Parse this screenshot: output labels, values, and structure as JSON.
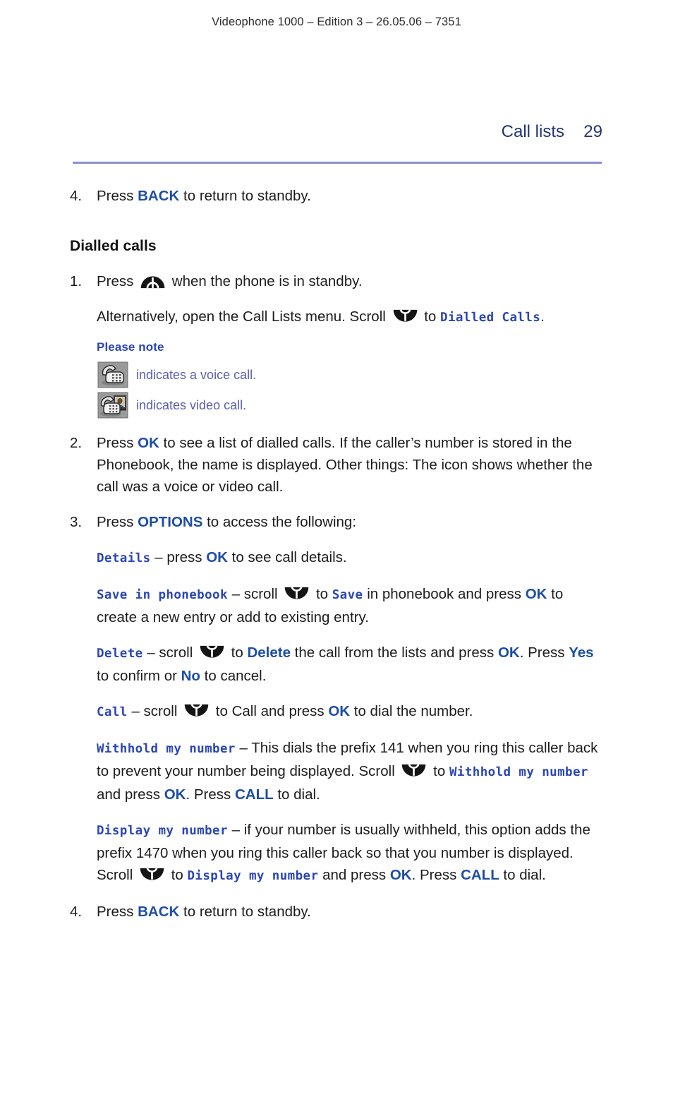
{
  "running_header": "Videophone 1000 – Edition 3 – 26.05.06 – 7351",
  "chapter": {
    "title": "Call lists",
    "page_number": "29"
  },
  "colors": {
    "rule": "#8b90ce",
    "chapter_heading": "#22356e",
    "key_blue": "#1d4ea4",
    "lcd_menu_blue": "#2a45b5",
    "note_text": "#5a5fae",
    "body_text": "#1c1c1c"
  },
  "steps": {
    "step4a": {
      "number": "4.",
      "text_1": "Press ",
      "key": "BACK",
      "text_2": " to return to standby."
    },
    "subheading": "Dialled calls",
    "step1": {
      "number": "1.",
      "line1_a": "Press ",
      "line1_b": " when the phone is in standby.",
      "line2_a": "Alternatively, open the Call Lists menu. Scroll ",
      "line2_b": " to ",
      "line2_menu": "Dialled Calls",
      "line2_c": "."
    },
    "please_note": {
      "title": "Please note",
      "voice": {
        "icon": "voice-call-icon",
        "text": "indicates a voice call."
      },
      "video": {
        "icon": "video-call-icon",
        "text": "indicates video call."
      }
    },
    "step2": {
      "number": "2.",
      "text_1": "Press ",
      "key": "OK",
      "text_2": " to see a list of dialled calls. If the caller’s number is stored in the Phonebook, the name is displayed. Other things: The icon shows whether the call was a voice or video call."
    },
    "step3": {
      "number": "3.",
      "text_1": "Press ",
      "key": "OPTIONS",
      "text_2": " to access the following:",
      "options": {
        "details": {
          "menu": "Details",
          "t1": " – press ",
          "key1": "OK",
          "t2": " to see call details."
        },
        "save_in_phonebook": {
          "menu": "Save in phonebook",
          "t1": " – scroll ",
          "t2": " to ",
          "menu2": "Save",
          "t3": " in phonebook and press ",
          "key1": "OK",
          "t4": " to create a new entry or add to existing entry."
        },
        "delete": {
          "menu": "Delete",
          "t1": " – scroll ",
          "t2": " to ",
          "key1": "Delete",
          "t3": " the call from the lists and press ",
          "key2": "OK",
          "t4": ". Press ",
          "key3": "Yes",
          "t5": " to confirm or ",
          "key4": "No",
          "t6": " to cancel."
        },
        "call": {
          "menu": "Call",
          "t1": " – scroll ",
          "t2": " to Call and press ",
          "key1": "OK",
          "t3": " to dial the number."
        },
        "withhold_my_number": {
          "menu": "Withhold my number",
          "t1": " – This dials the prefix 141 when you ring this caller back to prevent your number being displayed. Scroll ",
          "t2": " to ",
          "menu2": "Withhold my number",
          "t3": " and press ",
          "key1": "OK",
          "t4": ". Press ",
          "key2": "CALL",
          "t5": " to dial."
        },
        "display_my_number": {
          "menu": "Display my number",
          "t1": " – if your number is usually withheld, this option adds the prefix 1470 when you ring this caller back so that you number is displayed. Scroll ",
          "t2": " to ",
          "menu2": "Display my number",
          "t3": " and press ",
          "key1": "OK",
          "t4": ". Press ",
          "key2": "CALL",
          "t5": " to dial."
        }
      }
    },
    "step4b": {
      "number": "4.",
      "text_1": "Press ",
      "key": "BACK",
      "text_2": " to return to standby."
    }
  },
  "icons": {
    "up_scroll_key": "scroll-up-key-icon",
    "down_scroll_key": "scroll-down-key-icon",
    "voice_call": "voice-call-icon",
    "video_call": "video-call-icon"
  }
}
